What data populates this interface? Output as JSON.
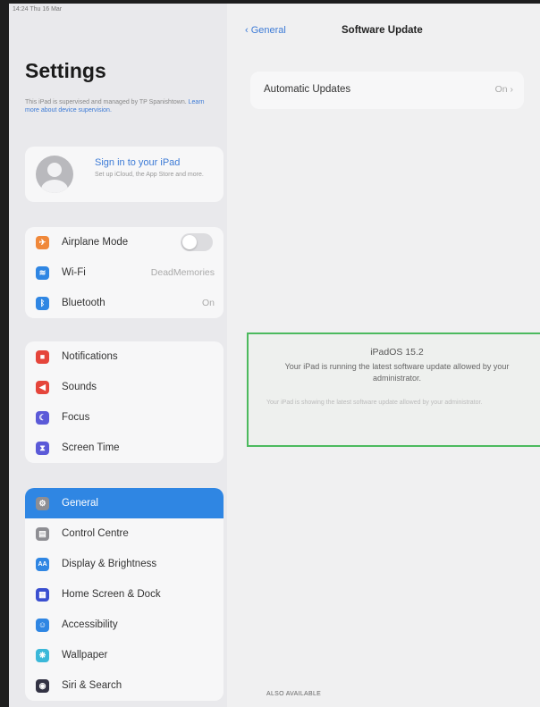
{
  "status": {
    "time_date": "14:24  Thu 16 Mar"
  },
  "sidebar": {
    "title": "Settings",
    "supervision_text": "This iPad is supervised and managed by TP Spanishtown.",
    "supervision_link": "Learn more about device supervision.",
    "account": {
      "title": "Sign in to your iPad",
      "subtitle": "Set up iCloud, the App Store and more."
    },
    "group1": [
      {
        "label": "Airplane Mode",
        "icon": "airplane-icon",
        "color": "#f0883a",
        "glyph": "✈",
        "value": ""
      },
      {
        "label": "Wi-Fi",
        "icon": "wifi-icon",
        "color": "#2f86e3",
        "glyph": "≋",
        "value": "DeadMemories"
      },
      {
        "label": "Bluetooth",
        "icon": "bluetooth-icon",
        "color": "#2f86e3",
        "glyph": "ᛒ",
        "value": "On"
      }
    ],
    "group2": [
      {
        "label": "Notifications",
        "icon": "notifications-icon",
        "color": "#e5453b",
        "glyph": "■"
      },
      {
        "label": "Sounds",
        "icon": "sounds-icon",
        "color": "#e5453b",
        "glyph": "◀"
      },
      {
        "label": "Focus",
        "icon": "focus-icon",
        "color": "#5b5ad8",
        "glyph": "☾"
      },
      {
        "label": "Screen Time",
        "icon": "screen-time-icon",
        "color": "#5b5ad8",
        "glyph": "⧗"
      }
    ],
    "group3": [
      {
        "label": "General",
        "icon": "gear-icon",
        "color": "#8e8e93",
        "glyph": "⚙"
      },
      {
        "label": "Control Centre",
        "icon": "control-centre-icon",
        "color": "#8e8e93",
        "glyph": "▤"
      },
      {
        "label": "Display & Brightness",
        "icon": "display-icon",
        "color": "#2f86e3",
        "glyph": "AA"
      },
      {
        "label": "Home Screen & Dock",
        "icon": "home-screen-icon",
        "color": "#3a4fd0",
        "glyph": "▦"
      },
      {
        "label": "Accessibility",
        "icon": "accessibility-icon",
        "color": "#2f86e3",
        "glyph": "☺"
      },
      {
        "label": "Wallpaper",
        "icon": "wallpaper-icon",
        "color": "#3bb8d9",
        "glyph": "❋"
      },
      {
        "label": "Siri & Search",
        "icon": "siri-icon",
        "color": "#333344",
        "glyph": "◉"
      }
    ]
  },
  "detail": {
    "back_label": "General",
    "title": "Software Update",
    "auto_label": "Automatic Updates",
    "auto_value": "On",
    "version": "iPadOS 15.2",
    "message": "Your iPad is running the latest software update allowed by your administrator.",
    "ghost_text": "Your iPad is showing the latest software update allowed by your administrator.",
    "also_available": "ALSO AVAILABLE"
  }
}
